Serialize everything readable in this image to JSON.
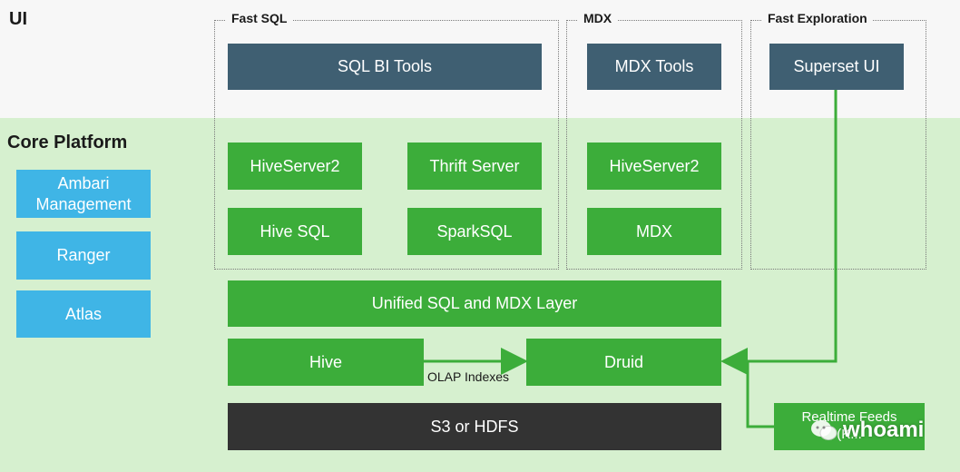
{
  "sections": {
    "ui": "UI",
    "core": "Core Platform"
  },
  "groups": {
    "fast_sql": "Fast SQL",
    "mdx": "MDX",
    "fast_exploration": "Fast Exploration"
  },
  "ui_tools": {
    "sql_bi": "SQL BI Tools",
    "mdx_tools": "MDX Tools",
    "superset": "Superset UI"
  },
  "core_left": {
    "ambari_line1": "Ambari",
    "ambari_line2": "Management",
    "ranger": "Ranger",
    "atlas": "Atlas"
  },
  "fast_sql_boxes": {
    "hiveserver2": "HiveServer2",
    "thrift": "Thrift Server",
    "hive_sql": "Hive SQL",
    "sparksql": "SparkSQL"
  },
  "mdx_boxes": {
    "hiveserver2": "HiveServer2",
    "mdx": "MDX"
  },
  "layers": {
    "unified": "Unified SQL and MDX Layer",
    "hive": "Hive",
    "druid": "Druid",
    "olap_label": "OLAP Indexes",
    "storage": "S3 or HDFS",
    "realtime_line1": "Realtime Feeds",
    "realtime_line2": "(K..."
  },
  "watermark": "whoami",
  "colors": {
    "slate": "#3f5f72",
    "green": "#3cad3a",
    "blue": "#3fb5e6",
    "dark": "#333333",
    "core_band": "#d6f0cf"
  }
}
